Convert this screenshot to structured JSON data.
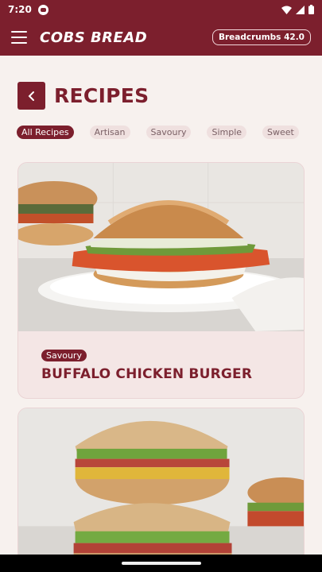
{
  "status": {
    "time": "7:20"
  },
  "header": {
    "brand": "COBS BREAD",
    "badge": "Breadcrumbs 42.0"
  },
  "page": {
    "title": "RECIPES"
  },
  "filters": [
    {
      "label": "All Recipes",
      "active": true
    },
    {
      "label": "Artisan"
    },
    {
      "label": "Savoury"
    },
    {
      "label": "Simple"
    },
    {
      "label": "Sweet"
    }
  ],
  "recipes": [
    {
      "tag": "Savoury",
      "title": "BUFFALO CHICKEN BURGER"
    }
  ],
  "colors": {
    "brand": "#7c1f2d",
    "background": "#f7f1ee",
    "chip": "#efe0df"
  }
}
